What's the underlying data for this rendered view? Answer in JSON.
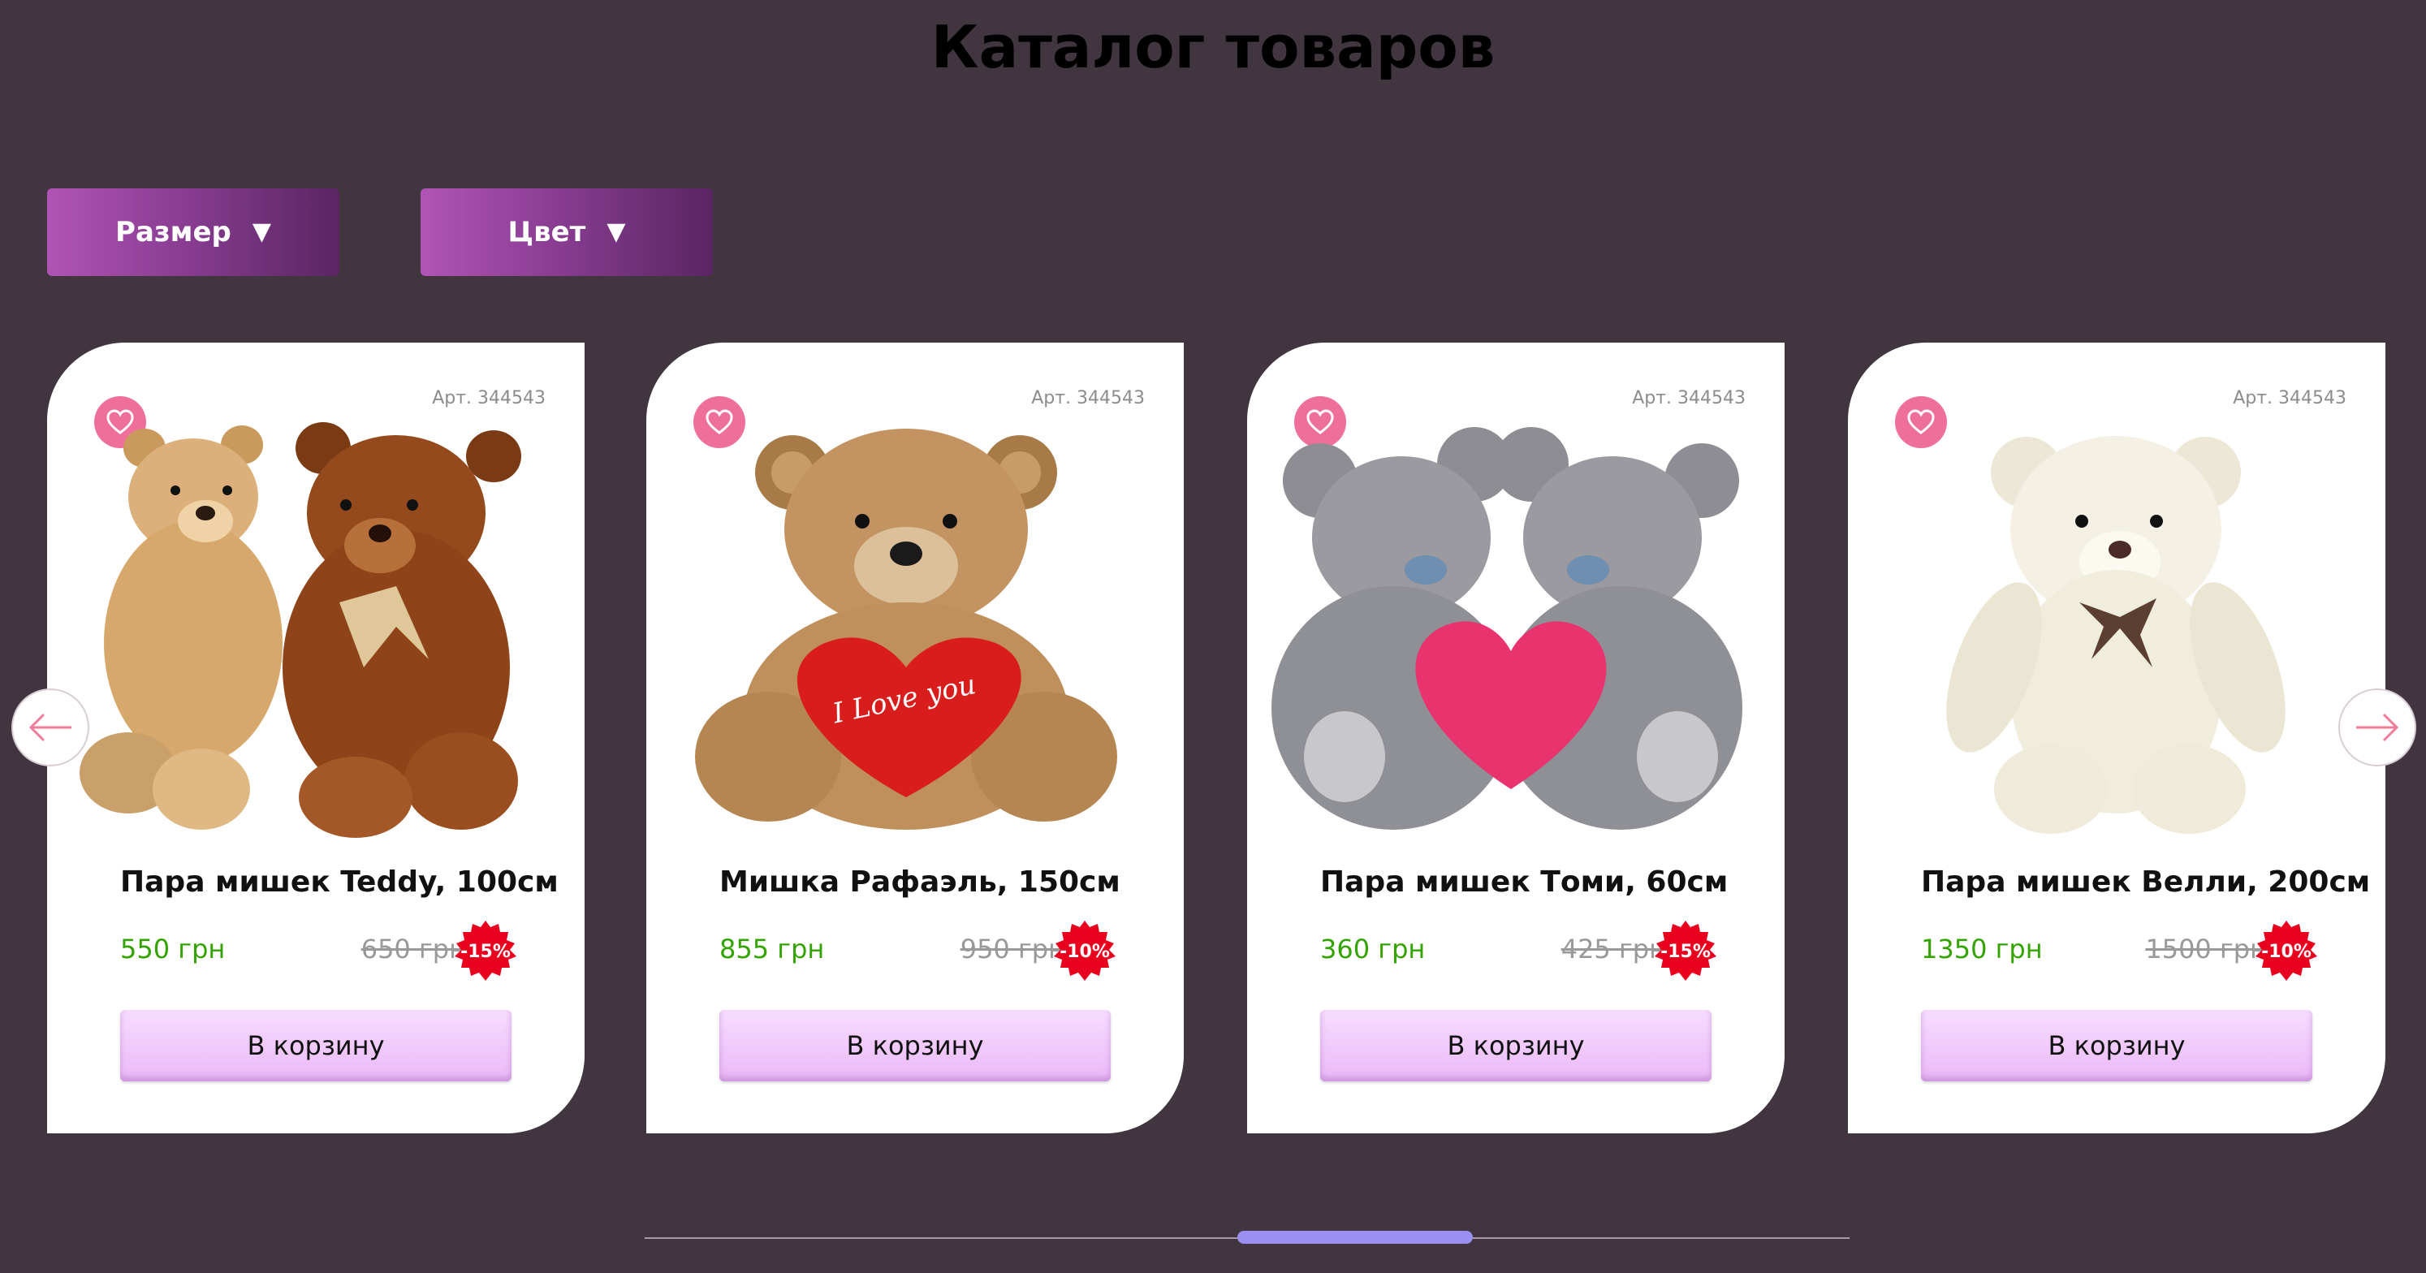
{
  "page": {
    "title": "Каталог товаров"
  },
  "filters": {
    "size_label": "Размер",
    "color_label": "Цвет"
  },
  "colors": {
    "background": "#413640",
    "price": "#33a300",
    "discount_badge": "#e8001e",
    "favorite": "#ef6f9b",
    "scrollbar_thumb": "#9b8ff0"
  },
  "products": [
    {
      "sku": "Арт. 344543",
      "name": "Пара мишек Teddy, 100см",
      "price": "550 грн",
      "old_price": "650 грн",
      "discount": "-15%",
      "cart_label": "В корзину",
      "image": "two-teddy-bears"
    },
    {
      "sku": "Арт. 344543",
      "name": "Мишка Рафаэль, 150см",
      "price": "855 грн",
      "old_price": "950 грн",
      "discount": "-10%",
      "cart_label": "В корзину",
      "image": "bear-with-heart",
      "heart_text": "I Love you"
    },
    {
      "sku": "Арт. 344543",
      "name": "Пара мишек Томи, 60см",
      "price": "360 грн",
      "old_price": "425 грн",
      "discount": "-15%",
      "cart_label": "В корзину",
      "image": "two-grey-bears-with-heart"
    },
    {
      "sku": "Арт. 344543",
      "name": "Пара мишек Велли, 200см",
      "price": "1350 грн",
      "old_price": "1500 грн",
      "discount": "-10%",
      "cart_label": "В корзину",
      "image": "white-teddy-bear"
    }
  ],
  "icons": {
    "favorite": "heart-icon",
    "prev": "arrow-left-icon",
    "next": "arrow-right-icon",
    "dropdown": "triangle-down-icon"
  }
}
